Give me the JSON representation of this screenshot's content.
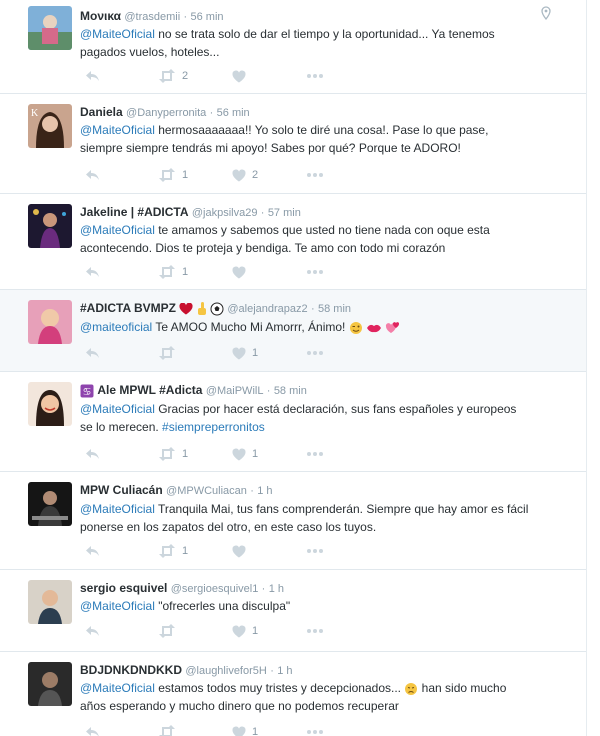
{
  "colors": {
    "accent": "#2b7bb9",
    "muted": "#8899a6",
    "border": "#e1e8ed",
    "highlight": "#f5f8fa"
  },
  "tweets": [
    {
      "name": "Μονικα",
      "handle": "@trasdemii",
      "sep": "·",
      "time": "56 min",
      "mention": "@MaiteOficial",
      "l1": " no se trata solo de dar el tiempo y la oportunidad... Ya tenemos",
      "l2": "pagados vuelos, hoteles...",
      "rt": "2",
      "like": ""
    },
    {
      "name": "Daniela",
      "handle": "@Danyperronita",
      "sep": "·",
      "time": "56 min",
      "mention": "@MaiteOficial",
      "l1": " hermosaaaaaaa!! Yo solo te diré una cosa!. Pase lo que pase,",
      "l2": "siempre siempre tendrás mi apoyo! Sabes por qué? Porque te ADORO!",
      "rt": "1",
      "like": "2"
    },
    {
      "name": "Jakeline | #ADICTA",
      "handle": "@jakpsilva29",
      "sep": "·",
      "time": "57 min",
      "mention": "@MaiteOficial",
      "l1": " te amamos y sabemos que usted no tiene nada con oque esta",
      "l2": "acontecendo. Dios te proteja y bendiga.  Te amo con todo mi corazón",
      "rt": "1",
      "like": ""
    },
    {
      "name": "#ADICTA BVMPZ",
      "handle": "@alejandrapaz2",
      "sep": "·",
      "time": "58 min",
      "mention": "@maiteoficial",
      "l1": " Te AMOO Mucho Mi Amorrr, Ánimo!",
      "rt": "",
      "like": "1"
    },
    {
      "name": "Ale MPWL #Adicta",
      "handle": "@MaiPWilL",
      "sep": "·",
      "time": "58 min",
      "mention": "@MaiteOficial",
      "l1": " Gracias por hacer está declaración, sus fans españoles y europeos",
      "l2a": "se lo merecen. ",
      "hashtag": "#siempreperronitos",
      "rt": "1",
      "like": "1"
    },
    {
      "name": "MPW Culiacán",
      "handle": "@MPWCuliacan",
      "sep": "·",
      "time": "1 h",
      "mention": "@MaiteOficial",
      "l1": " Tranquila Mai, tus fans comprenderán. Siempre que hay amor es fácil",
      "l2": "ponerse en los zapatos del otro, en este caso los tuyos.",
      "rt": "1",
      "like": ""
    },
    {
      "name": "sergio esquivel",
      "handle": "@sergioesquivel1",
      "sep": "·",
      "time": "1 h",
      "mention": "@MaiteOficial",
      "l1": " \"ofrecerles una disculpa\"",
      "rt": "",
      "like": "1"
    },
    {
      "name": "BDJDNKDNDKKD",
      "handle": "@laughlivefor5H",
      "sep": "·",
      "time": "1 h",
      "mention": "@MaiteOficial",
      "l1a": " estamos todos muy tristes y decepcionados...",
      "l1b": " han sido mucho",
      "l2": "años esperando y mucho dinero que no podemos recuperar",
      "rt": "",
      "like": "1"
    }
  ]
}
